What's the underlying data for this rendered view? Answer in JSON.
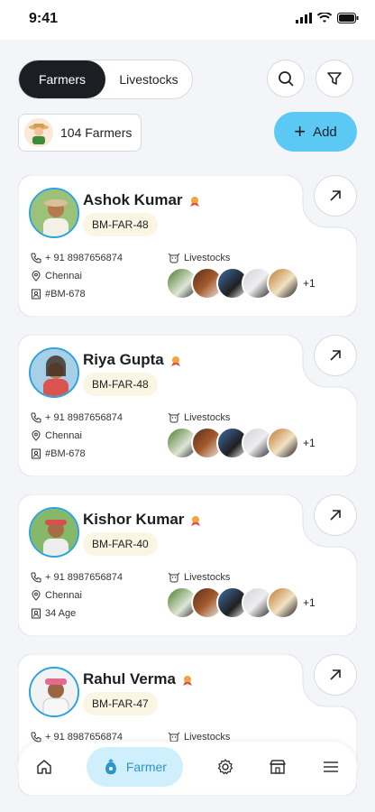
{
  "status": {
    "time": "9:41"
  },
  "tabs": [
    {
      "label": "Farmers",
      "active": true
    },
    {
      "label": "Livestocks",
      "active": false
    }
  ],
  "count_label": "104 Farmers",
  "add_label": "Add",
  "livestocks_label": "Livestocks",
  "farmers": [
    {
      "name": "Ashok Kumar",
      "code": "BM-FAR-48",
      "phone": "+ 91 8987656874",
      "city": "Chennai",
      "extra": "#BM-678",
      "more": "+1"
    },
    {
      "name": "Riya Gupta",
      "code": "BM-FAR-48",
      "phone": "+ 91 8987656874",
      "city": "Chennai",
      "extra": "#BM-678",
      "more": "+1"
    },
    {
      "name": "Kishor Kumar",
      "code": "BM-FAR-40",
      "phone": "+ 91 8987656874",
      "city": "Chennai",
      "extra": "34 Age",
      "more": "+1"
    },
    {
      "name": "Rahul Verma",
      "code": "BM-FAR-47",
      "phone": "+ 91 8987656874",
      "city": "",
      "extra": "",
      "more": ""
    }
  ],
  "nav": {
    "active_label": "Farmer"
  },
  "colors": {
    "accent": "#5cc9f5",
    "dark": "#1b1f24",
    "pill": "#cfeffc"
  }
}
